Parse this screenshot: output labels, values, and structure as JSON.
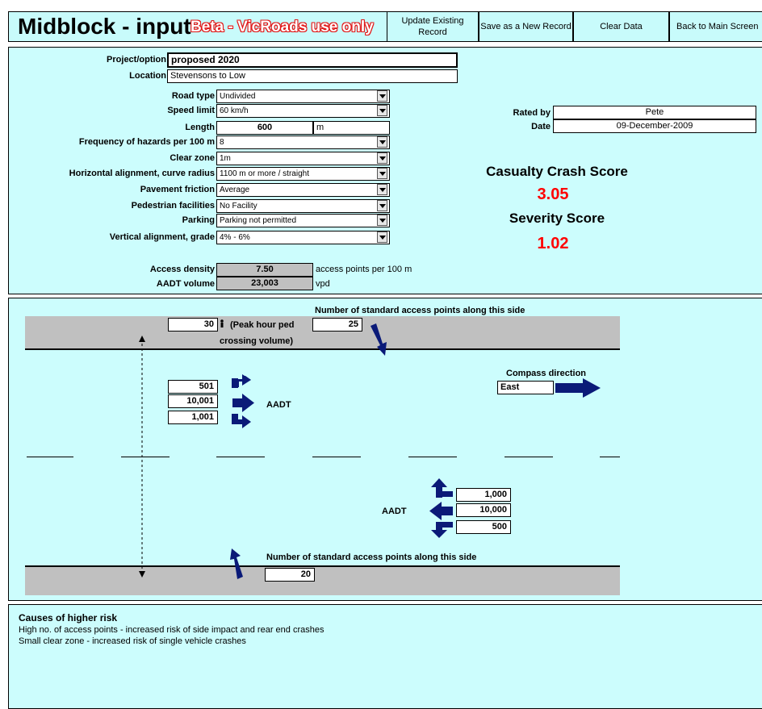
{
  "header": {
    "title": "Midblock - input",
    "beta": "Beta - VicRoads use only",
    "buttons": {
      "update": "Update Existing Record",
      "save_new": "Save as a New Record",
      "clear": "Clear Data",
      "back": "Back to Main Screen"
    }
  },
  "form": {
    "project_label": "Project/option",
    "project_value": "proposed 2020",
    "location_label": "Location",
    "location_value": "Stevensons to Low",
    "road_type_label": "Road type",
    "road_type_value": "Undivided",
    "speed_label": "Speed limit",
    "speed_value": "60 km/h",
    "length_label": "Length",
    "length_value": "600",
    "length_unit": "m",
    "hazards_label": "Frequency of hazards per 100 m",
    "hazards_value": "8",
    "clearzone_label": "Clear zone",
    "clearzone_value": "1m",
    "horiz_label": "Horizontal alignment, curve radius",
    "horiz_value": "1100 m or more / straight",
    "friction_label": "Pavement friction",
    "friction_value": "Average",
    "ped_label": "Pedestrian facilities",
    "ped_value": "No Facility",
    "parking_label": "Parking",
    "parking_value": "Parking not permitted",
    "vert_label": "Vertical alignment, grade",
    "vert_value": "4% - 6%",
    "access_label": "Access density",
    "access_value": "7.50",
    "access_unit": "access points per 100 m",
    "aadt_label": "AADT volume",
    "aadt_value": "23,003",
    "aadt_unit": "vpd",
    "rated_label": "Rated by",
    "rated_value": "Pete",
    "date_label": "Date",
    "date_value": "09-December-2009"
  },
  "scores": {
    "casualty_label": "Casualty Crash Score",
    "casualty_value": "3.05",
    "severity_label": "Severity Score",
    "severity_value": "1.02"
  },
  "diagram": {
    "top_access_label": "Number of standard access points along this side",
    "ped_volume": "30",
    "ped_label_1": "(Peak hour ped",
    "ped_label_2": "crossing volume)",
    "top_access_value": "25",
    "compass_label": "Compass direction",
    "compass_value": "East",
    "west_left": "501",
    "west_through": "10,001",
    "west_right": "1,001",
    "aadt_left_label": "AADT",
    "east_left": "1,000",
    "east_through": "10,000",
    "east_right": "500",
    "aadt_right_label": "AADT",
    "bottom_access_label": "Number of standard access points along this side",
    "bottom_access_value": "20",
    "arrow_color": "#0a1a78"
  },
  "risk": {
    "title": "Causes of higher risk",
    "items": [
      "High no. of access points - increased risk of side impact and rear end crashes",
      "Small clear zone - increased risk of single vehicle crashes"
    ]
  }
}
